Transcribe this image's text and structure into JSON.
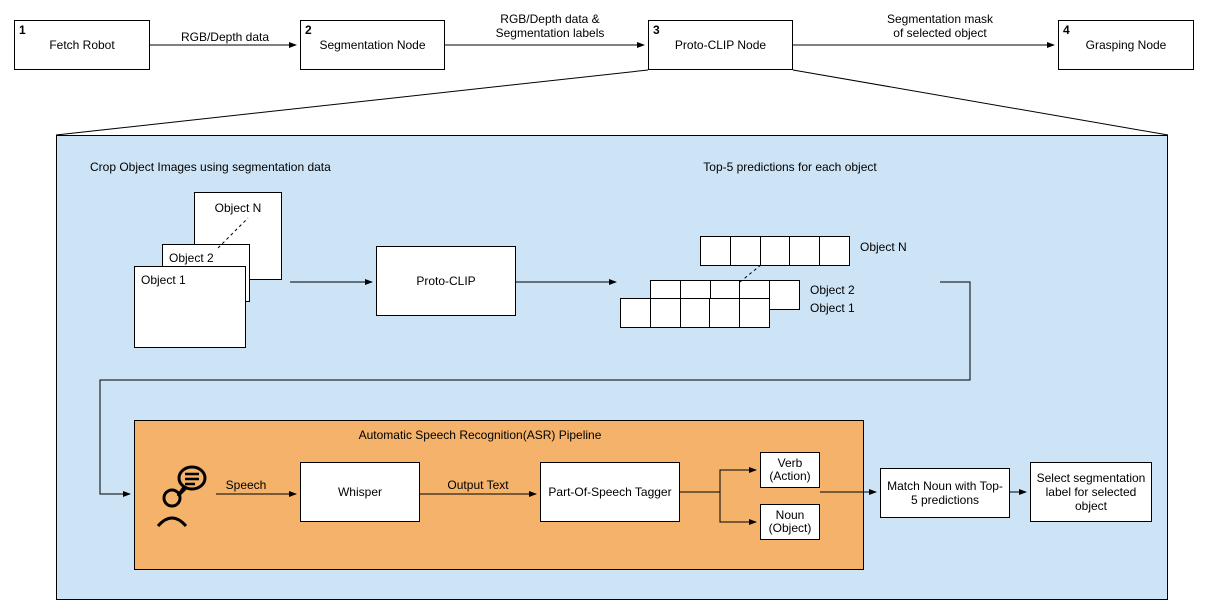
{
  "top_nodes": {
    "n1": {
      "num": "1",
      "label": "Fetch Robot"
    },
    "n2": {
      "num": "2",
      "label": "Segmentation Node"
    },
    "n3": {
      "num": "3",
      "label": "Proto-CLIP Node"
    },
    "n4": {
      "num": "4",
      "label": "Grasping Node"
    }
  },
  "top_edges": {
    "e12": "RGB/Depth data",
    "e23_l1": "RGB/Depth data &",
    "e23_l2": "Segmentation labels",
    "e34_l1": "Segmentation mask",
    "e34_l2": "of selected object"
  },
  "blue": {
    "crop_title": "Crop Object Images using segmentation data",
    "obj1": "Object 1",
    "obj2": "Object 2",
    "objN": "Object N",
    "protoclip": "Proto-CLIP",
    "top5_title": "Top-5 predictions for each object",
    "pred_obj1": "Object 1",
    "pred_obj2": "Object 2",
    "pred_objN": "Object N"
  },
  "asr": {
    "title": "Automatic Speech Recognition(ASR) Pipeline",
    "speech": "Speech",
    "whisper": "Whisper",
    "output_text": "Output Text",
    "pos_tagger": "Part-Of-Speech Tagger",
    "verb_l1": "Verb",
    "verb_l2": "(Action)",
    "noun_l1": "Noun",
    "noun_l2": "(Object)"
  },
  "right": {
    "match_l1": "Match Noun with Top-",
    "match_l2": "5 predictions",
    "select_l1": "Select segmentation",
    "select_l2": "label for selected",
    "select_l3": "object"
  },
  "chart_data": {
    "type": "flowchart",
    "nodes": [
      {
        "id": 1,
        "label": "Fetch Robot"
      },
      {
        "id": 2,
        "label": "Segmentation Node"
      },
      {
        "id": 3,
        "label": "Proto-CLIP Node"
      },
      {
        "id": 4,
        "label": "Grasping Node"
      }
    ],
    "edges": [
      {
        "from": 1,
        "to": 2,
        "label": "RGB/Depth data"
      },
      {
        "from": 2,
        "to": 3,
        "label": "RGB/Depth data & Segmentation labels"
      },
      {
        "from": 3,
        "to": 4,
        "label": "Segmentation mask of selected object"
      }
    ],
    "expansion_of_node": 3,
    "expansion": {
      "crop_step": "Crop Object Images using segmentation data",
      "objects": [
        "Object 1",
        "Object 2",
        "Object N"
      ],
      "model": "Proto-CLIP",
      "predictions_step": "Top-5 predictions for each object",
      "prediction_slots_per_object": 5,
      "asr_pipeline": {
        "title": "Automatic Speech Recognition(ASR) Pipeline",
        "input": "Speech",
        "steps": [
          "Whisper",
          "Part-Of-Speech Tagger"
        ],
        "intermediate": "Output Text",
        "outputs": [
          "Verb (Action)",
          "Noun (Object)"
        ]
      },
      "post_steps": [
        "Match Noun with Top-5 predictions",
        "Select segmentation label for selected object"
      ]
    }
  }
}
